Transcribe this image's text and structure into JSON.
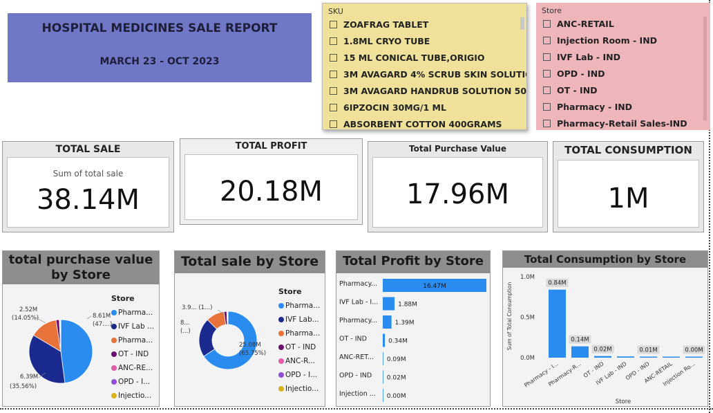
{
  "report": {
    "title": "HOSPITAL MEDICINES SALE REPORT",
    "period": "MARCH 23 - OCT 2023"
  },
  "sku_slicer": {
    "header": "SKU",
    "items": [
      "ZOAFRAG TABLET",
      "1.8ML CRYO TUBE",
      "15 ML CONICAL TUBE,ORIGIO",
      "3M AVAGARD 4% SCRUB SKIN SOLUTIO...",
      "3M AVAGARD HANDRUB SOLUTION 500...",
      "6IPZOCIN 30MG/1 ML",
      "ABSORBENT COTTON 400GRAMS"
    ]
  },
  "store_slicer": {
    "header": "Store",
    "items": [
      "ANC-RETAIL",
      "Injection Room - IND",
      "IVF Lab - IND",
      "OPD - IND",
      "OT - IND",
      "Pharmacy - IND",
      "Pharmacy-Retail Sales-IND"
    ]
  },
  "kpis": {
    "total_sale": {
      "header": "TOTAL SALE",
      "sub": "Sum of total sale",
      "value": "38.14M"
    },
    "total_profit": {
      "header": "TOTAL PROFIT",
      "value": "20.18M"
    },
    "purchase_value": {
      "header": "Total Purchase Value",
      "value": "17.96M"
    },
    "consumption": {
      "header": "TOTAL CONSUMPTION",
      "value": "1M"
    }
  },
  "colors": {
    "blue": "#2b8cf0",
    "navy": "#1b2a8f",
    "orange": "#e8733a",
    "purple": "#6b0f6f",
    "pink": "#e35ca8",
    "violet": "#8f4fd8",
    "gold": "#dcb21a"
  },
  "chart_data": [
    {
      "type": "pie",
      "title": "total purchase value by Store",
      "legend_title": "Store",
      "legend": [
        "Pharma...",
        "IVF Lab ...",
        "Pharma...",
        "OT - IND",
        "ANC-RE...",
        "OPD - I...",
        "Injectio..."
      ],
      "slices": [
        {
          "value": 8.61,
          "label": "8.61M",
          "pct": "(47....)"
        },
        {
          "value": 6.39,
          "label": "6.39M",
          "pct": "(35.56%)"
        },
        {
          "value": 2.52,
          "label": "2.52M",
          "pct": "(14.05%)"
        },
        {
          "value": 0.3
        },
        {
          "value": 0.06
        },
        {
          "value": 0.05
        },
        {
          "value": 0.03
        }
      ]
    },
    {
      "type": "pie",
      "title": "Total sale by Store",
      "legend_title": "Store",
      "legend": [
        "Pharma...",
        "IVF Lab...",
        "Pharma...",
        "OT - IND",
        "ANC-R...",
        "OPD - I...",
        "Injectio..."
      ],
      "slices": [
        {
          "value": 25.08,
          "label": "25.08M",
          "pct": "(65.75%)"
        },
        {
          "value": 8.3,
          "label": "8...",
          "pct": "(...)"
        },
        {
          "value": 3.9,
          "label": "3.9... (1...)"
        },
        {
          "value": 0.6
        },
        {
          "value": 0.15
        },
        {
          "value": 0.07
        },
        {
          "value": 0.04
        }
      ]
    },
    {
      "type": "bar",
      "title": "Total Profit by Store",
      "categories": [
        "Pharmacy...",
        "IVF Lab - I...",
        "Pharmacy...",
        "OT - IND",
        "ANC-RET...",
        "OPD - IND",
        "Injection ..."
      ],
      "values": [
        16.47,
        1.88,
        1.39,
        0.34,
        0.09,
        0.02,
        0.0
      ],
      "labels": [
        "16.47M",
        "1.88M",
        "1.39M",
        "0.34M",
        "0.09M",
        "0.02M",
        "0.00M"
      ]
    },
    {
      "type": "bar",
      "title": "Total Consumption by Store",
      "xlabel": "Store",
      "ylabel": "Sum of Total Consumption",
      "categories": [
        "Pharmacy - I...",
        "Pharmacy-R...",
        "OT - IND",
        "IVF Lab - IND",
        "OPD - IND",
        "ANC-RETAIL",
        "Injection Ro..."
      ],
      "values": [
        0.84,
        0.14,
        0.02,
        0.015,
        0.01,
        0.004,
        0.002
      ],
      "labels": [
        "0.84M",
        "0.14M",
        "0.02M",
        "",
        "0.01M",
        "",
        "0.00M"
      ],
      "yticks": [
        "0.0M",
        "0.5M",
        "1.0M"
      ],
      "ylim": [
        0,
        1.0
      ]
    }
  ]
}
